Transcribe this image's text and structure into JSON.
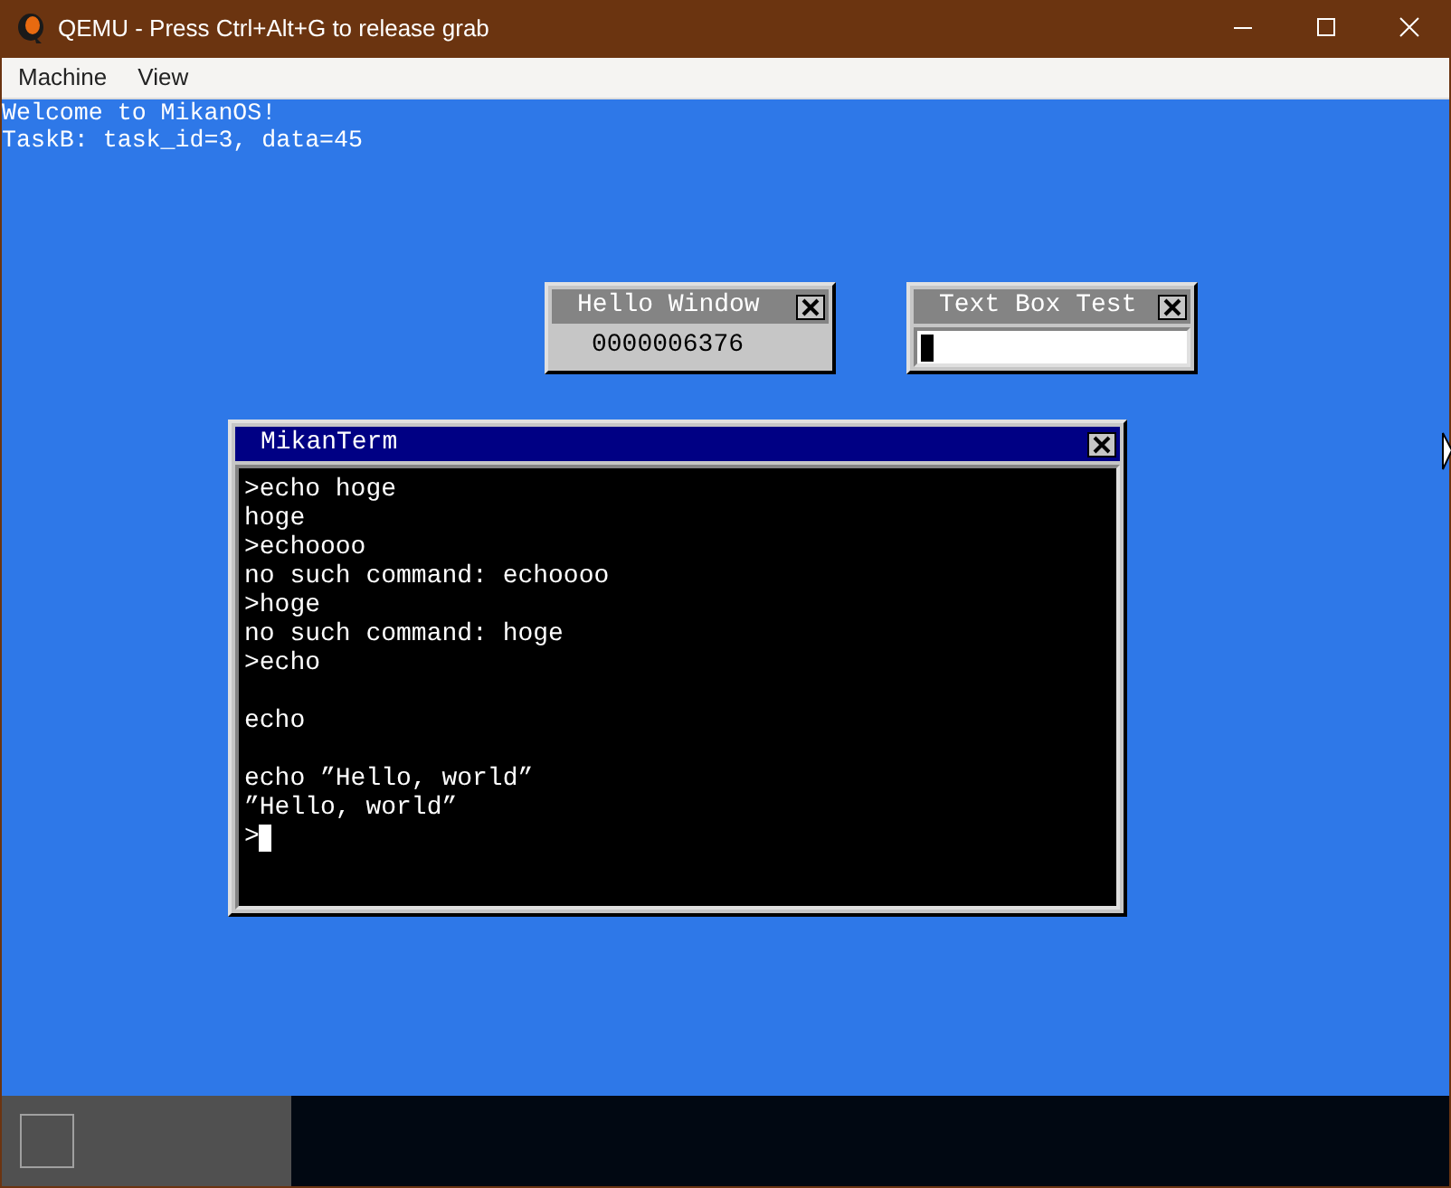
{
  "window": {
    "title": "QEMU - Press Ctrl+Alt+G to release grab"
  },
  "menu": [
    "Machine",
    "View"
  ],
  "console_lines": [
    "Welcome to MikanOS!",
    "TaskB: task_id=3, data=45"
  ],
  "hello_window": {
    "title": "Hello Window",
    "counter": "0000006376"
  },
  "textbox_window": {
    "title": "Text Box Test",
    "cursor": true
  },
  "terminal": {
    "title": "MikanTerm",
    "active": true,
    "lines": [
      {
        "kind": "text",
        "text": ">echo hoge"
      },
      {
        "kind": "text",
        "text": "hoge"
      },
      {
        "kind": "text",
        "text": ">echoooo"
      },
      {
        "kind": "text",
        "text": "no such command: echoooo"
      },
      {
        "kind": "text",
        "text": ">hoge"
      },
      {
        "kind": "text",
        "text": "no such command: hoge"
      },
      {
        "kind": "text",
        "text": ">echo"
      },
      {
        "kind": "blank"
      },
      {
        "kind": "text",
        "text": "echo"
      },
      {
        "kind": "blank"
      },
      {
        "kind": "text",
        "text": "echo ”Hello, world”"
      },
      {
        "kind": "text",
        "text": "”Hello, world”"
      },
      {
        "kind": "prompt",
        "text": ">"
      }
    ]
  }
}
